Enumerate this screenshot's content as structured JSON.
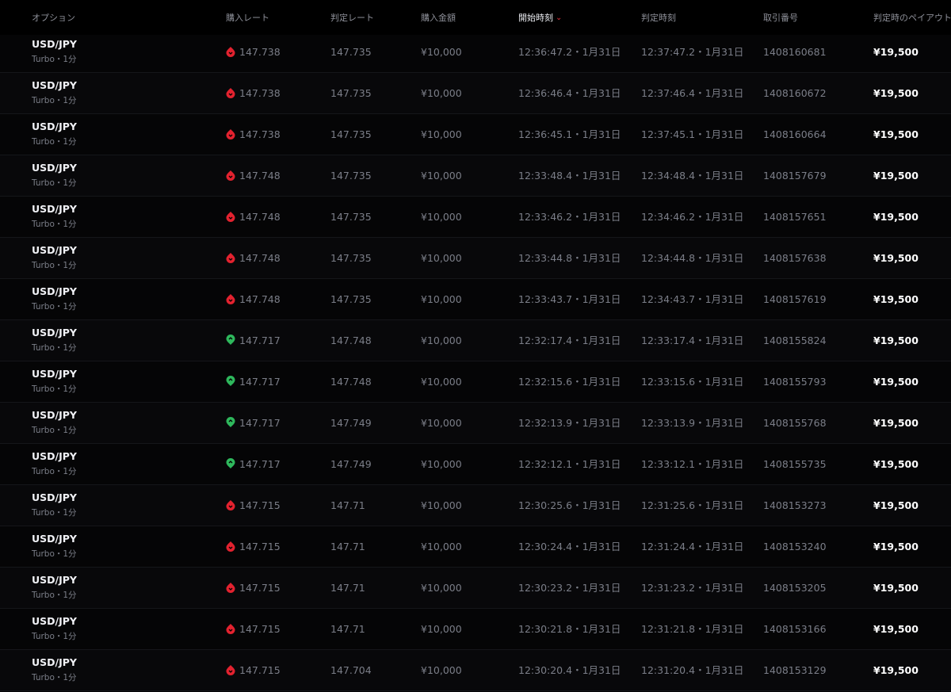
{
  "colors": {
    "background": "#000000",
    "header_text": "#8d8f98",
    "cell_text": "#7b7e88",
    "primary_text": "#f1f2f6",
    "down_icon": "#e3222f",
    "up_icon": "#2eb85c",
    "sort_accent": "#e5323b"
  },
  "headers": {
    "option": "オプション",
    "purchase_rate": "購入レート",
    "settle_rate": "判定レート",
    "amount": "購入金額",
    "start_time": "開始時刻",
    "settle_time": "判定時刻",
    "trade_id": "取引番号",
    "payout": "判定時のペイアウト"
  },
  "sort_icon": "chevron-down-icon",
  "rows": [
    {
      "pair": "USD/JPY",
      "sub": "Turbo・1分",
      "direction": "down",
      "purchase_rate": "147.738",
      "settle_rate": "147.735",
      "amount": "¥10,000",
      "start_time": "12:36:47.2・1月31日",
      "settle_time": "12:37:47.2・1月31日",
      "trade_id": "1408160681",
      "payout": "¥19,500"
    },
    {
      "pair": "USD/JPY",
      "sub": "Turbo・1分",
      "direction": "down",
      "purchase_rate": "147.738",
      "settle_rate": "147.735",
      "amount": "¥10,000",
      "start_time": "12:36:46.4・1月31日",
      "settle_time": "12:37:46.4・1月31日",
      "trade_id": "1408160672",
      "payout": "¥19,500"
    },
    {
      "pair": "USD/JPY",
      "sub": "Turbo・1分",
      "direction": "down",
      "purchase_rate": "147.738",
      "settle_rate": "147.735",
      "amount": "¥10,000",
      "start_time": "12:36:45.1・1月31日",
      "settle_time": "12:37:45.1・1月31日",
      "trade_id": "1408160664",
      "payout": "¥19,500"
    },
    {
      "pair": "USD/JPY",
      "sub": "Turbo・1分",
      "direction": "down",
      "purchase_rate": "147.748",
      "settle_rate": "147.735",
      "amount": "¥10,000",
      "start_time": "12:33:48.4・1月31日",
      "settle_time": "12:34:48.4・1月31日",
      "trade_id": "1408157679",
      "payout": "¥19,500"
    },
    {
      "pair": "USD/JPY",
      "sub": "Turbo・1分",
      "direction": "down",
      "purchase_rate": "147.748",
      "settle_rate": "147.735",
      "amount": "¥10,000",
      "start_time": "12:33:46.2・1月31日",
      "settle_time": "12:34:46.2・1月31日",
      "trade_id": "1408157651",
      "payout": "¥19,500"
    },
    {
      "pair": "USD/JPY",
      "sub": "Turbo・1分",
      "direction": "down",
      "purchase_rate": "147.748",
      "settle_rate": "147.735",
      "amount": "¥10,000",
      "start_time": "12:33:44.8・1月31日",
      "settle_time": "12:34:44.8・1月31日",
      "trade_id": "1408157638",
      "payout": "¥19,500"
    },
    {
      "pair": "USD/JPY",
      "sub": "Turbo・1分",
      "direction": "down",
      "purchase_rate": "147.748",
      "settle_rate": "147.735",
      "amount": "¥10,000",
      "start_time": "12:33:43.7・1月31日",
      "settle_time": "12:34:43.7・1月31日",
      "trade_id": "1408157619",
      "payout": "¥19,500"
    },
    {
      "pair": "USD/JPY",
      "sub": "Turbo・1分",
      "direction": "up",
      "purchase_rate": "147.717",
      "settle_rate": "147.748",
      "amount": "¥10,000",
      "start_time": "12:32:17.4・1月31日",
      "settle_time": "12:33:17.4・1月31日",
      "trade_id": "1408155824",
      "payout": "¥19,500"
    },
    {
      "pair": "USD/JPY",
      "sub": "Turbo・1分",
      "direction": "up",
      "purchase_rate": "147.717",
      "settle_rate": "147.748",
      "amount": "¥10,000",
      "start_time": "12:32:15.6・1月31日",
      "settle_time": "12:33:15.6・1月31日",
      "trade_id": "1408155793",
      "payout": "¥19,500"
    },
    {
      "pair": "USD/JPY",
      "sub": "Turbo・1分",
      "direction": "up",
      "purchase_rate": "147.717",
      "settle_rate": "147.749",
      "amount": "¥10,000",
      "start_time": "12:32:13.9・1月31日",
      "settle_time": "12:33:13.9・1月31日",
      "trade_id": "1408155768",
      "payout": "¥19,500"
    },
    {
      "pair": "USD/JPY",
      "sub": "Turbo・1分",
      "direction": "up",
      "purchase_rate": "147.717",
      "settle_rate": "147.749",
      "amount": "¥10,000",
      "start_time": "12:32:12.1・1月31日",
      "settle_time": "12:33:12.1・1月31日",
      "trade_id": "1408155735",
      "payout": "¥19,500"
    },
    {
      "pair": "USD/JPY",
      "sub": "Turbo・1分",
      "direction": "down",
      "purchase_rate": "147.715",
      "settle_rate": "147.71",
      "amount": "¥10,000",
      "start_time": "12:30:25.6・1月31日",
      "settle_time": "12:31:25.6・1月31日",
      "trade_id": "1408153273",
      "payout": "¥19,500"
    },
    {
      "pair": "USD/JPY",
      "sub": "Turbo・1分",
      "direction": "down",
      "purchase_rate": "147.715",
      "settle_rate": "147.71",
      "amount": "¥10,000",
      "start_time": "12:30:24.4・1月31日",
      "settle_time": "12:31:24.4・1月31日",
      "trade_id": "1408153240",
      "payout": "¥19,500"
    },
    {
      "pair": "USD/JPY",
      "sub": "Turbo・1分",
      "direction": "down",
      "purchase_rate": "147.715",
      "settle_rate": "147.71",
      "amount": "¥10,000",
      "start_time": "12:30:23.2・1月31日",
      "settle_time": "12:31:23.2・1月31日",
      "trade_id": "1408153205",
      "payout": "¥19,500"
    },
    {
      "pair": "USD/JPY",
      "sub": "Turbo・1分",
      "direction": "down",
      "purchase_rate": "147.715",
      "settle_rate": "147.71",
      "amount": "¥10,000",
      "start_time": "12:30:21.8・1月31日",
      "settle_time": "12:31:21.8・1月31日",
      "trade_id": "1408153166",
      "payout": "¥19,500"
    },
    {
      "pair": "USD/JPY",
      "sub": "Turbo・1分",
      "direction": "down",
      "purchase_rate": "147.715",
      "settle_rate": "147.704",
      "amount": "¥10,000",
      "start_time": "12:30:20.4・1月31日",
      "settle_time": "12:31:20.4・1月31日",
      "trade_id": "1408153129",
      "payout": "¥19,500"
    }
  ]
}
